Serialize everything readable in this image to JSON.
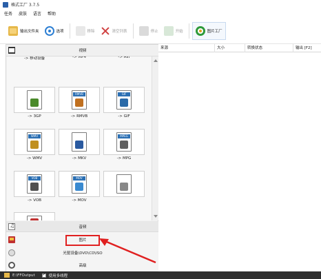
{
  "window": {
    "title": "格式工厂 3.7.5"
  },
  "menu": [
    "任务",
    "皮肤",
    "语言",
    "帮助"
  ],
  "toolbar": {
    "output_folder": "输出文件夹",
    "options": "选项",
    "remove": "移除",
    "clear_list": "清空列表",
    "stop": "停止",
    "start": "开始",
    "picture_factory": "图片工厂"
  },
  "categories": {
    "video": "视频",
    "audio": "音频",
    "picture": "图片",
    "rom": "光驱设备\\DVD\\CD\\ISO",
    "advanced": "高级"
  },
  "formats": [
    {
      "label": "-> 移动设备",
      "tag": "",
      "color": "#444444"
    },
    {
      "label": "-> MP4",
      "tag": "",
      "color": "#555555"
    },
    {
      "label": "-> AVI",
      "tag": "AVI",
      "color": "#3a7a3a"
    },
    {
      "label": "-> 3GP",
      "tag": "",
      "color": "#4a8a2a"
    },
    {
      "label": "-> RMVB",
      "tag": "RMVB",
      "color": "#c07020"
    },
    {
      "label": "-> GIF",
      "tag": "GIF",
      "color": "#2a6aa8"
    },
    {
      "label": "-> WMV",
      "tag": "WMV",
      "color": "#c09020"
    },
    {
      "label": "-> MKV",
      "tag": "",
      "color": "#2a5aa0"
    },
    {
      "label": "-> MPG",
      "tag": "MPEG",
      "color": "#606060"
    },
    {
      "label": "-> VOB",
      "tag": "VOB",
      "color": "#505050"
    },
    {
      "label": "-> MOV",
      "tag": "MOV",
      "color": "#3a8ad0"
    },
    {
      "label": "",
      "tag": "",
      "color": "#888888"
    },
    {
      "label": "",
      "tag": "",
      "color": "#c03030"
    }
  ],
  "table": {
    "source": "来源",
    "size": "大小",
    "status": "转换状态",
    "output": "输出 [F2]"
  },
  "status": {
    "path": "E:\\FFOutput",
    "multithread": "使用多线程"
  }
}
